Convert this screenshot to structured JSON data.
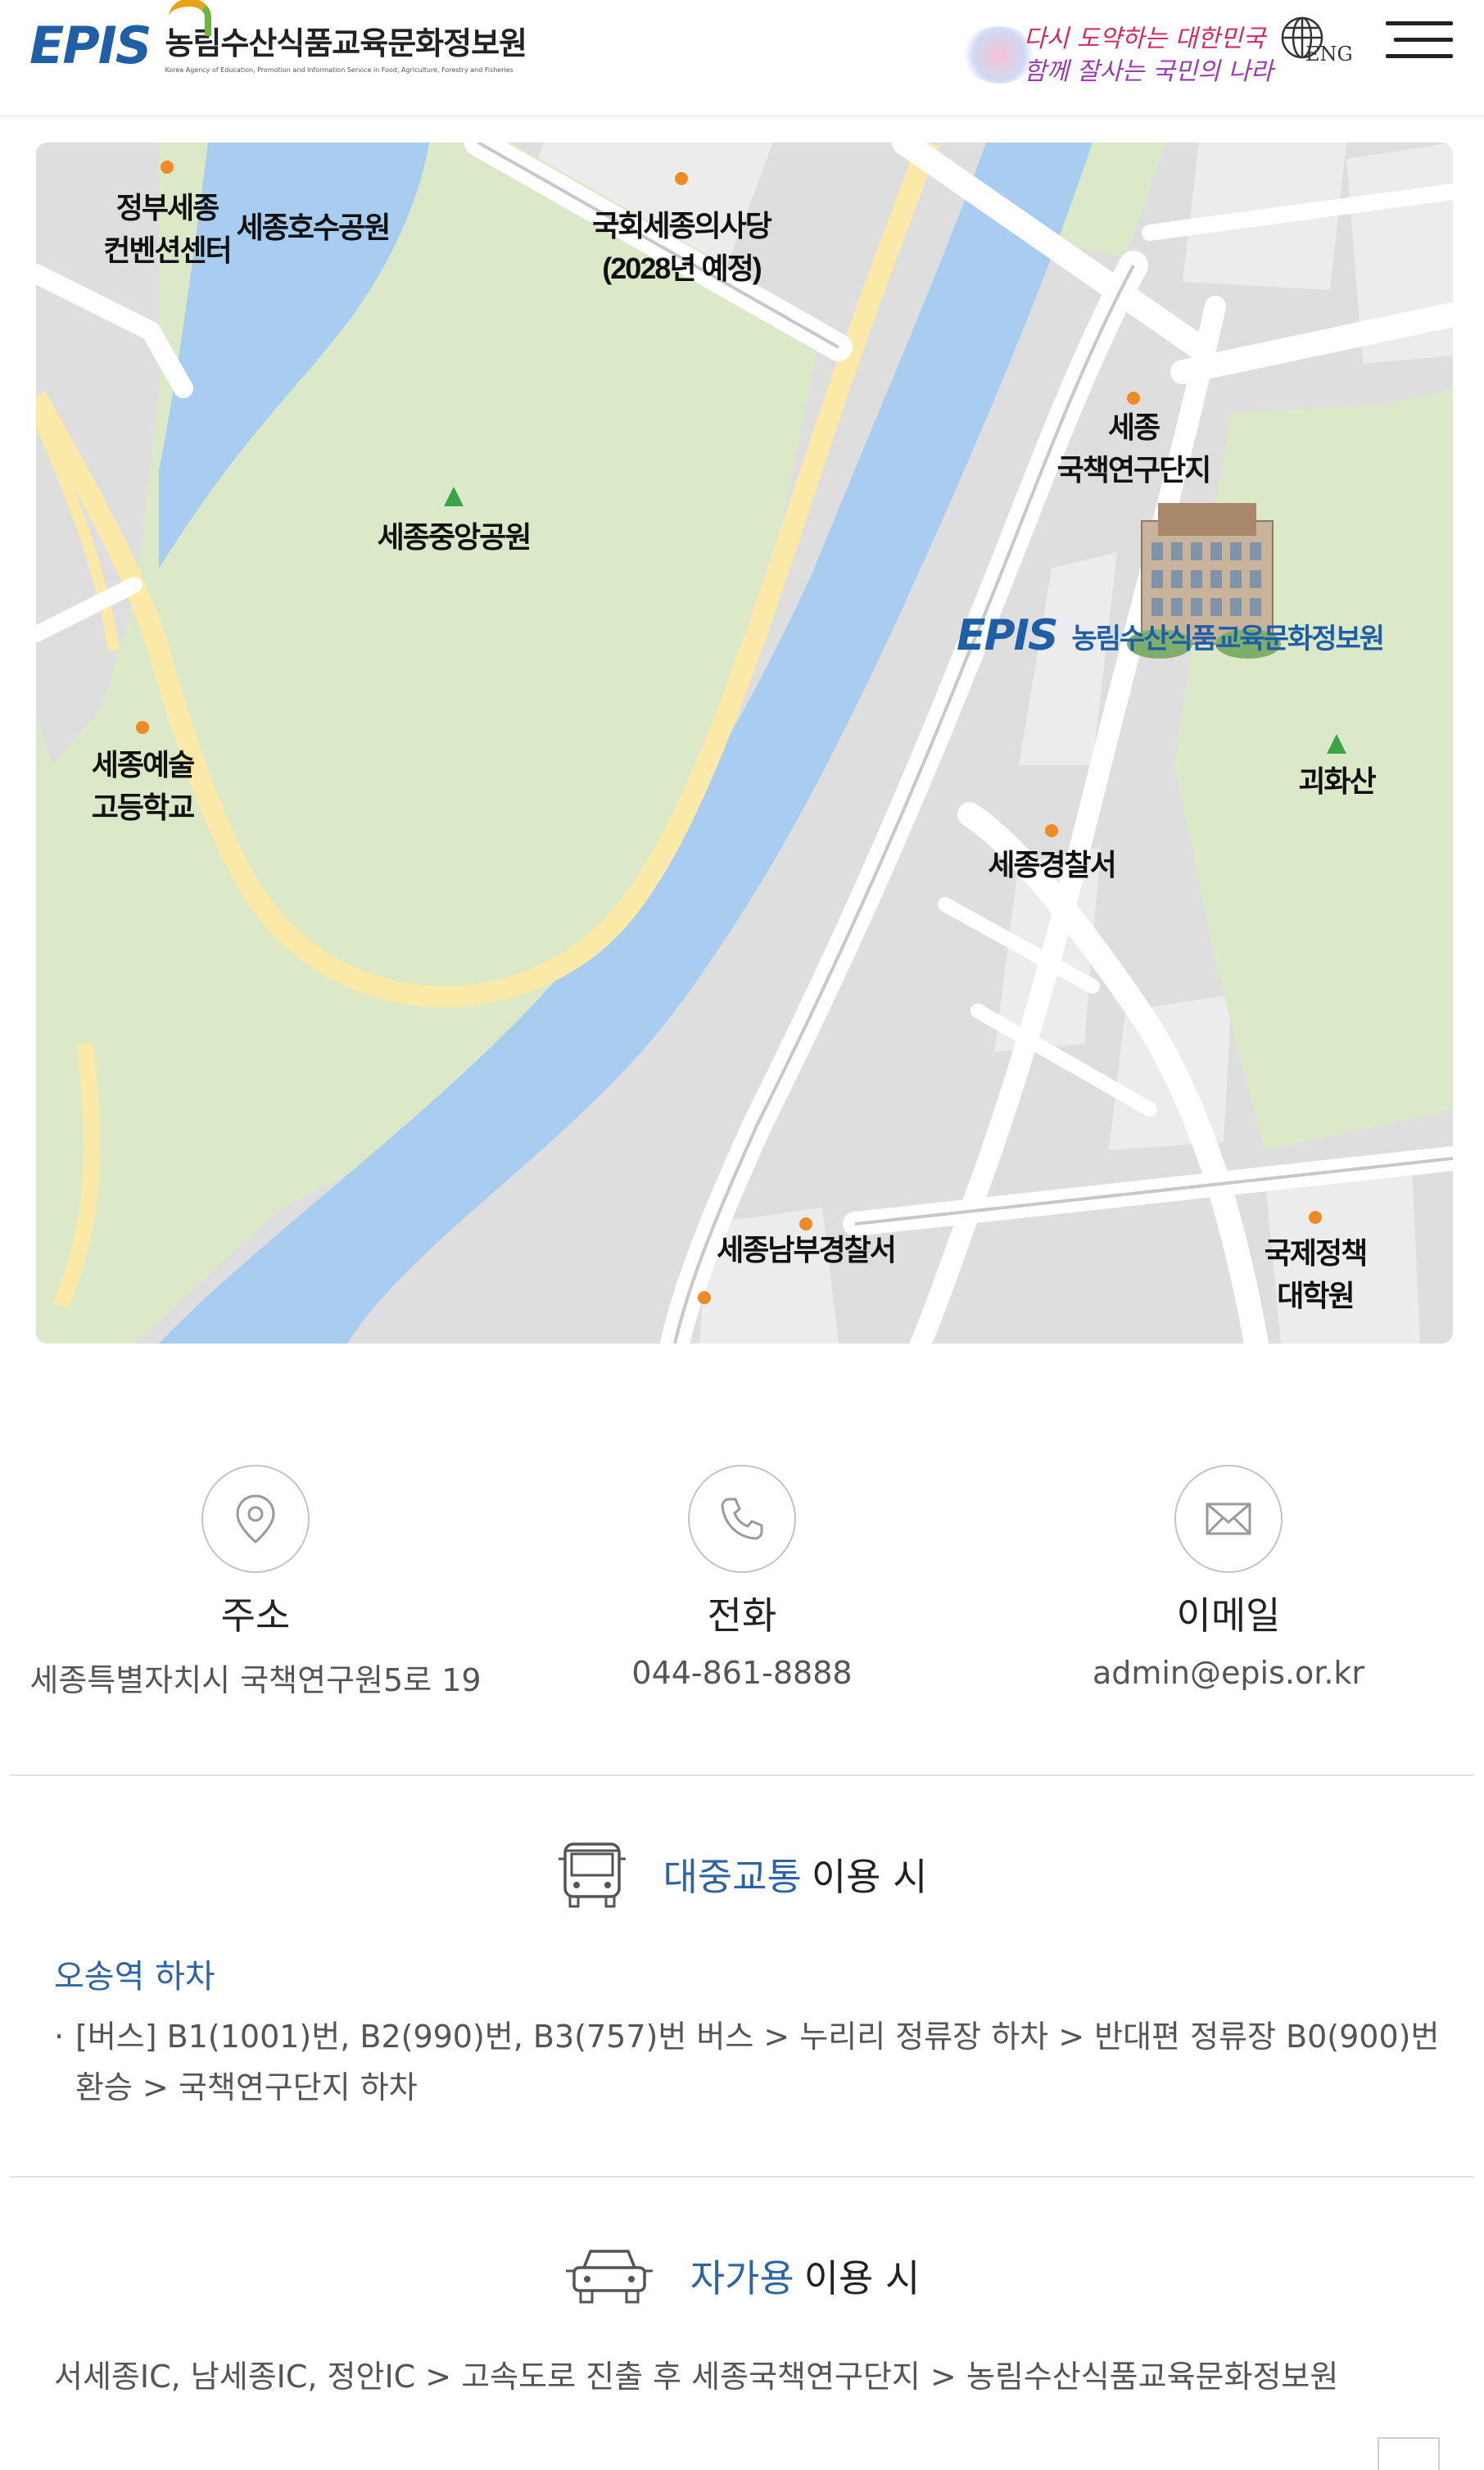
{
  "header": {
    "logo_mark": "EPIS",
    "org_name": "농림수산식품교육문화정보원",
    "org_name_en": "Korea Agency of Education, Promotion and Information Service in Food, Agriculture, Forestry and Fisheries",
    "slogan_line1": "다시 도약하는 대한민국",
    "slogan_line2": "함께 잘사는 국민의 나라",
    "lang_label": "ENG"
  },
  "map": {
    "labels": {
      "gov_convention": "정부세종\n컨벤션센터",
      "lake_park": "세종호수공원",
      "assembly": "국회세종의사당\n(2028년 예정)",
      "central_park": "세종중앙공원",
      "research_complex": "세종\n국책연구단지",
      "art_school": "세종예술\n고등학교",
      "mountain": "괴화산",
      "police": "세종경찰서",
      "south_police": "세종남부경찰서",
      "kdi_school": "국제정책\n대학원"
    },
    "epis_logo": "EPIS",
    "epis_name": "농림수산식품교육문화정보원"
  },
  "contacts": {
    "address": {
      "title": "주소",
      "value": "세종특별자치시 국책연구원5로 19",
      "icon": "location-pin-icon"
    },
    "phone": {
      "title": "전화",
      "value": "044-861-8888",
      "icon": "phone-icon"
    },
    "email": {
      "title": "이메일",
      "value": "admin@epis.or.kr",
      "icon": "mail-icon"
    }
  },
  "transit": {
    "title_highlight": "대중교통",
    "title_rest": "이용 시",
    "icon": "bus-icon",
    "stop_title": "오송역 하차",
    "bullet_marker": "·",
    "route": "[버스] B1(1001)번, B2(990)번, B3(757)번 버스 > 누리리 정류장 하차 > 반대편 정류장 B0(900)번 환승 > 국책연구단지 하차"
  },
  "car": {
    "title_highlight": "자가용",
    "title_rest": "이용 시",
    "icon": "car-icon",
    "route": "서세종IC, 남세종IC, 정안IC > 고속도로 진출 후 세종국책연구단지 > 농림수산식품교육문화정보원"
  },
  "colors": {
    "brand_blue": "#1f5fa8",
    "heading_blue": "#2c64a5",
    "park_green": "#dbe9c9",
    "river_blue": "#a9cdf0",
    "road_yellow": "#fbe9a8",
    "poi_orange": "#f08a24"
  }
}
